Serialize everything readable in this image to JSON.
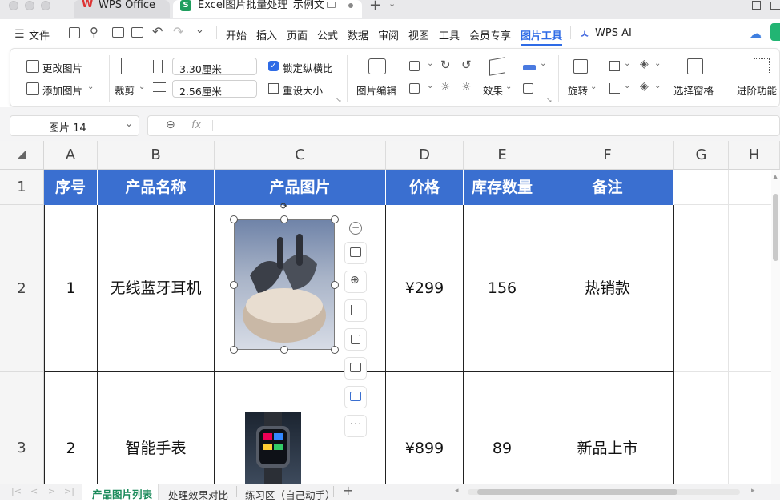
{
  "titlebar": {
    "tabs": [
      {
        "label": "WPS Office"
      },
      {
        "label": "Excel图片批量处理_示例文"
      }
    ]
  },
  "menu": {
    "file_label": "文件",
    "items": [
      "开始",
      "插入",
      "页面",
      "公式",
      "数据",
      "审阅",
      "视图",
      "工具",
      "会员专享",
      "图片工具",
      "WPS AI"
    ],
    "active": "图片工具"
  },
  "ribbon": {
    "change_picture": "更改图片",
    "add_picture": "添加图片",
    "crop": "裁剪",
    "width_value": "3.30厘米",
    "height_value": "2.56厘米",
    "lock_ratio": "锁定纵横比",
    "reset_size": "重设大小",
    "picture_edit": "图片编辑",
    "effects": "效果",
    "rotate": "旋转",
    "selection_pane": "选择窗格",
    "advanced": "进阶功能"
  },
  "formula_bar": {
    "name_box": "图片 14",
    "fx": "fx",
    "formula": ""
  },
  "columns": [
    "A",
    "B",
    "C",
    "D",
    "E",
    "F",
    "G",
    "H"
  ],
  "rows": [
    "1",
    "2",
    "3"
  ],
  "table": {
    "headers": [
      "序号",
      "产品名称",
      "产品图片",
      "价格",
      "库存数量",
      "备注"
    ],
    "rows": [
      {
        "seq": "1",
        "name": "无线蓝牙耳机",
        "price": "¥299",
        "stock": "156",
        "note": "热销款"
      },
      {
        "seq": "2",
        "name": "智能手表",
        "price": "¥899",
        "stock": "89",
        "note": "新品上市"
      }
    ]
  },
  "sheets": {
    "tabs": [
      "产品图片列表",
      "处理效果对比",
      "练习区（自己动手）"
    ],
    "active": "产品图片列表"
  },
  "colors": {
    "header_fill": "#3a6fd0",
    "accent": "#2e6be6",
    "sheet_active": "#1a8a5a"
  }
}
